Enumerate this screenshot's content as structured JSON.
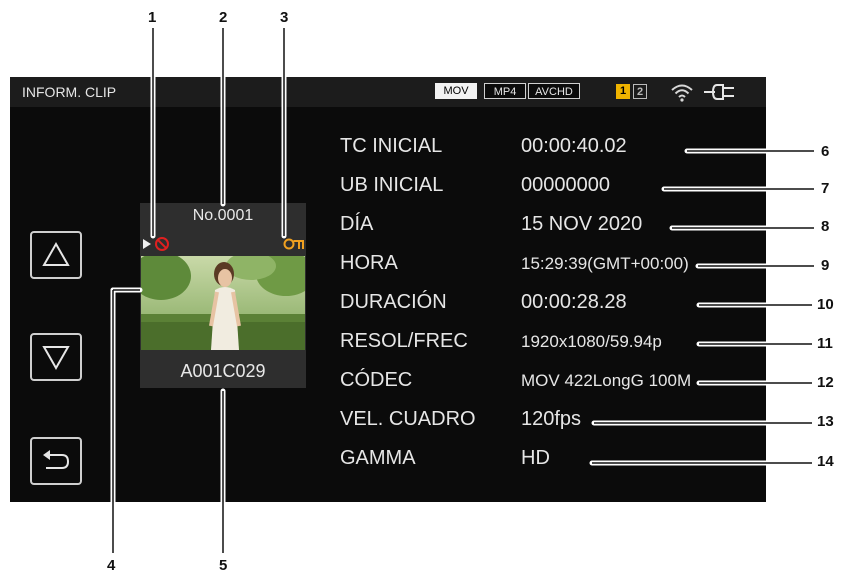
{
  "callouts": {
    "n1": "1",
    "n2": "2",
    "n3": "3",
    "n4": "4",
    "n5": "5",
    "n6": "6",
    "n7": "7",
    "n8": "8",
    "n9": "9",
    "n10": "10",
    "n11": "11",
    "n12": "12",
    "n13": "13",
    "n14": "14"
  },
  "header": {
    "title": "INFORM. CLIP",
    "formats": [
      "MOV",
      "MP4",
      "AVCHD"
    ],
    "active_format": "MOV",
    "slots": [
      "1",
      "2"
    ],
    "active_slot": "1",
    "wifi_icon": "wifi-icon",
    "power_icon": "ac-power-plug-icon"
  },
  "clip": {
    "number": "No.0001",
    "name": "A001C029",
    "status_icons": [
      "play-icon",
      "prohibited-icon",
      "protect-key-icon"
    ]
  },
  "nav": {
    "up_icon": "triangle-up-icon",
    "down_icon": "triangle-down-icon",
    "back_icon": "return-arrow-icon"
  },
  "info": [
    {
      "label": "TC INICIAL",
      "value": "00:00:40.02"
    },
    {
      "label": "UB INICIAL",
      "value": "00000000"
    },
    {
      "label": "DÍA",
      "value": "15 NOV 2020"
    },
    {
      "label": "HORA",
      "value": "15:29:39(GMT+00:00)"
    },
    {
      "label": "DURACIÓN",
      "value": "00:00:28.28"
    },
    {
      "label": "RESOL/FREC",
      "value": "1920x1080/59.94p"
    },
    {
      "label": "CÓDEC",
      "value": "MOV 422LongG 100M"
    },
    {
      "label": "VEL. CUADRO",
      "value": "120fps"
    },
    {
      "label": "GAMMA",
      "value": "HD"
    }
  ],
  "colors": {
    "screen_bg": "#0b0b0b",
    "text": "#e6e6e6",
    "slot_active": "#f0b400",
    "protect_key": "#f0a020",
    "prohibited": "#e02020"
  }
}
